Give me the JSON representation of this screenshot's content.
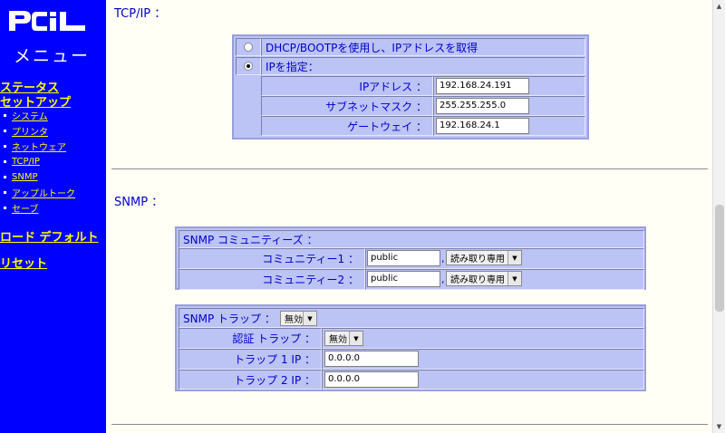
{
  "sidebar": {
    "logo_text": "PCi",
    "menu_title": "メニュー",
    "status_link": "ステータス",
    "setup_link": "セットアップ",
    "nav_items": [
      {
        "label": "システム"
      },
      {
        "label": "プリンタ"
      },
      {
        "label": "ネットウェア"
      },
      {
        "label": "TCP/IP"
      },
      {
        "label": "SNMP"
      },
      {
        "label": "アップルトーク"
      },
      {
        "label": "セーブ"
      }
    ],
    "load_default_link": "ロード デフォルト",
    "reset_link": "リセット"
  },
  "tcpip": {
    "heading": "TCP/IP ：",
    "dhcp_label": "DHCP/BOOTPを使用し、IPアドレスを取得",
    "dhcp_selected": false,
    "ip_specify_label": "IPを指定：",
    "ip_specify_selected": true,
    "ip_address_label": "IPアドレス ：",
    "ip_address_value": "192.168.24.191",
    "subnet_label": "サブネットマスク ：",
    "subnet_value": "255.255.255.0",
    "gateway_label": "ゲートウェイ ：",
    "gateway_value": "192.168.24.1"
  },
  "snmp": {
    "heading": "SNMP ：",
    "communities_header": "SNMP コミュニティーズ ：",
    "community1_label": "コミュニティー1 ：",
    "community1_value": "public",
    "community1_access": "読み取り専用",
    "community2_label": "コミュニティー2 ：",
    "community2_value": "public",
    "community2_access": "読み取り専用",
    "comma": ",",
    "trap_label": "SNMP トラップ ：",
    "trap_value": "無効",
    "auth_trap_label": "認証 トラップ ：",
    "auth_trap_value": "無効",
    "trap1_label": "トラップ 1 IP ：",
    "trap1_value": "0.0.0.0",
    "trap2_label": "トラップ 2 IP ：",
    "trap2_value": "0.0.0.0"
  },
  "colors": {
    "sidebar_bg": "#0000ff",
    "link": "#ffff00",
    "panel": "#bcc3f5",
    "text": "#0000cc",
    "page_bg": "#fffff6"
  }
}
